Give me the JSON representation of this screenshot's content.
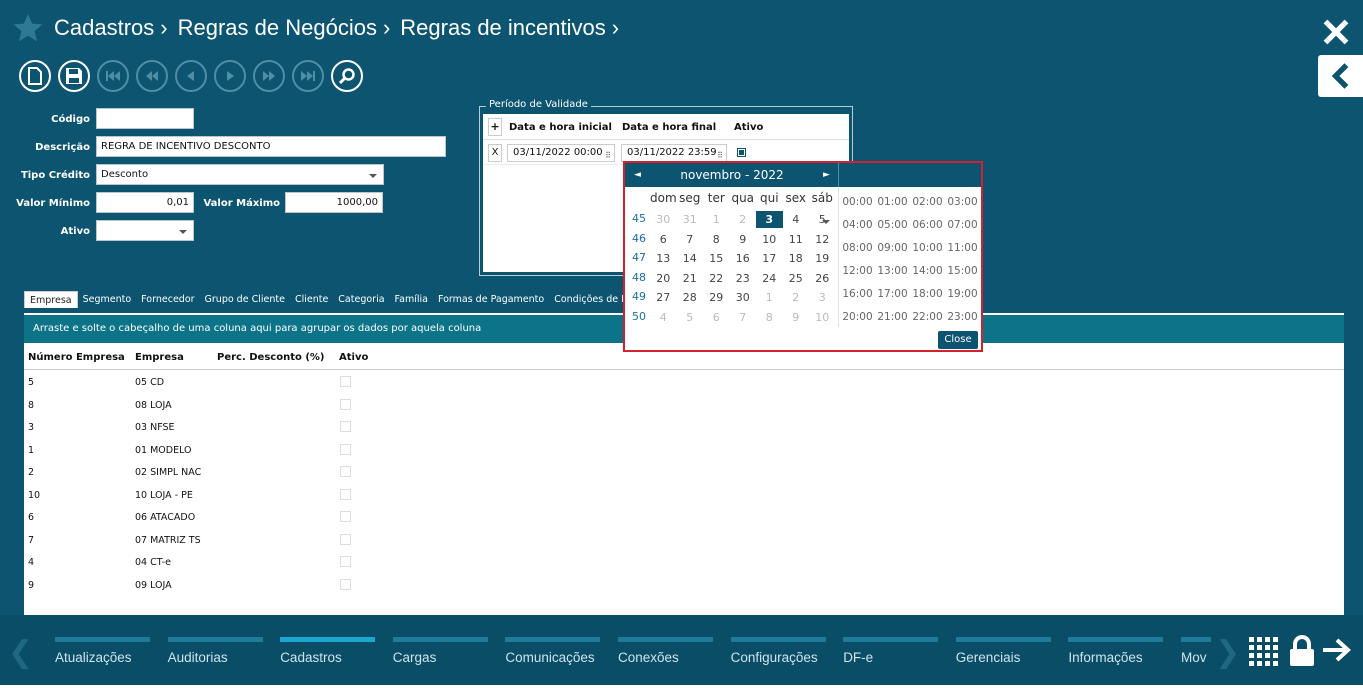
{
  "header": {
    "breadcrumb": [
      "Cadastros",
      "Regras de Negócios",
      "Regras de incentivos"
    ],
    "separator": "›"
  },
  "form": {
    "codigo_label": "Código",
    "codigo_value": "",
    "descricao_label": "Descrição",
    "descricao_value": "REGRA DE INCENTIVO DESCONTO",
    "tipo_credito_label": "Tipo Crédito",
    "tipo_credito_value": "Desconto",
    "valor_minimo_label": "Valor Mínimo",
    "valor_minimo_value": "0,01",
    "valor_maximo_label": "Valor Máximo",
    "valor_maximo_value": "1000,00",
    "ativo_label": "Ativo",
    "ativo_value": ""
  },
  "validity": {
    "legend": "Período de Validade",
    "add_label": "+",
    "col_start": "Data e hora inicial",
    "col_end": "Data e hora final",
    "col_active": "Ativo",
    "remove_label": "X",
    "start_value": "03/11/2022 00:00",
    "end_value": "03/11/2022 23:59"
  },
  "calendar": {
    "month_title": "novembro - 2022",
    "prev": "◄",
    "next": "►",
    "day_names": [
      "dom",
      "seg",
      "ter",
      "qua",
      "qui",
      "sex",
      "sáb"
    ],
    "weeks": [
      {
        "week": "45",
        "days": [
          "30",
          "31",
          "1",
          "2",
          "3",
          "4",
          "5"
        ],
        "other": [
          true,
          true,
          true,
          true,
          false,
          false,
          false
        ]
      },
      {
        "week": "46",
        "days": [
          "6",
          "7",
          "8",
          "9",
          "10",
          "11",
          "12"
        ],
        "other": [
          false,
          false,
          false,
          false,
          false,
          false,
          false
        ]
      },
      {
        "week": "47",
        "days": [
          "13",
          "14",
          "15",
          "16",
          "17",
          "18",
          "19"
        ],
        "other": [
          false,
          false,
          false,
          false,
          false,
          false,
          false
        ]
      },
      {
        "week": "48",
        "days": [
          "20",
          "21",
          "22",
          "23",
          "24",
          "25",
          "26"
        ],
        "other": [
          false,
          false,
          false,
          false,
          false,
          false,
          false
        ]
      },
      {
        "week": "49",
        "days": [
          "27",
          "28",
          "29",
          "30",
          "1",
          "2",
          "3"
        ],
        "other": [
          false,
          false,
          false,
          false,
          true,
          true,
          true
        ]
      },
      {
        "week": "50",
        "days": [
          "4",
          "5",
          "6",
          "7",
          "8",
          "9",
          "10"
        ],
        "other": [
          true,
          true,
          true,
          true,
          true,
          true,
          true
        ]
      }
    ],
    "selected_day": "3",
    "times": [
      "00:00",
      "01:00",
      "02:00",
      "03:00",
      "04:00",
      "05:00",
      "06:00",
      "07:00",
      "08:00",
      "09:00",
      "10:00",
      "11:00",
      "12:00",
      "13:00",
      "14:00",
      "15:00",
      "16:00",
      "17:00",
      "18:00",
      "19:00",
      "20:00",
      "21:00",
      "22:00",
      "23:00"
    ],
    "close_label": "Close"
  },
  "tabs": [
    {
      "label": "Empresa",
      "active": true
    },
    {
      "label": "Segmento",
      "active": false
    },
    {
      "label": "Fornecedor",
      "active": false
    },
    {
      "label": "Grupo de Cliente",
      "active": false
    },
    {
      "label": "Cliente",
      "active": false
    },
    {
      "label": "Categoria",
      "active": false
    },
    {
      "label": "Família",
      "active": false
    },
    {
      "label": "Formas de Pagamento",
      "active": false
    },
    {
      "label": "Condições de Pagamento",
      "active": false
    }
  ],
  "grid": {
    "group_hint": "Arraste e solte o cabeçalho de uma coluna aqui para agrupar os dados por aquela coluna",
    "columns": [
      "Número Empresa",
      "Empresa",
      "Perc. Desconto (%)",
      "Ativo"
    ],
    "rows": [
      {
        "num": "5",
        "empresa": "05 CD"
      },
      {
        "num": "8",
        "empresa": "08 LOJA"
      },
      {
        "num": "3",
        "empresa": "03 NFSE"
      },
      {
        "num": "1",
        "empresa": "01 MODELO"
      },
      {
        "num": "2",
        "empresa": "02 SIMPL NAC"
      },
      {
        "num": "10",
        "empresa": "10 LOJA - PE"
      },
      {
        "num": "6",
        "empresa": "06 ATACADO"
      },
      {
        "num": "7",
        "empresa": "07 MATRIZ TS"
      },
      {
        "num": "4",
        "empresa": "04 CT-e"
      },
      {
        "num": "9",
        "empresa": "09 LOJA"
      }
    ]
  },
  "modules": [
    {
      "label": "Atualizações",
      "active": false
    },
    {
      "label": "Auditorias",
      "active": false
    },
    {
      "label": "Cadastros",
      "active": true
    },
    {
      "label": "Cargas",
      "active": false
    },
    {
      "label": "Comunicações",
      "active": false
    },
    {
      "label": "Conexões",
      "active": false
    },
    {
      "label": "Configurações",
      "active": false
    },
    {
      "label": "DF-e",
      "active": false
    },
    {
      "label": "Gerenciais",
      "active": false
    },
    {
      "label": "Informações",
      "active": false
    },
    {
      "label": "Mov",
      "active": false
    }
  ],
  "nav_arrows": {
    "left": "❮",
    "right": "❯"
  },
  "colors": {
    "background": "#0c5470",
    "accent": "#1aa8d0",
    "highlight_border": "#d5202e"
  }
}
